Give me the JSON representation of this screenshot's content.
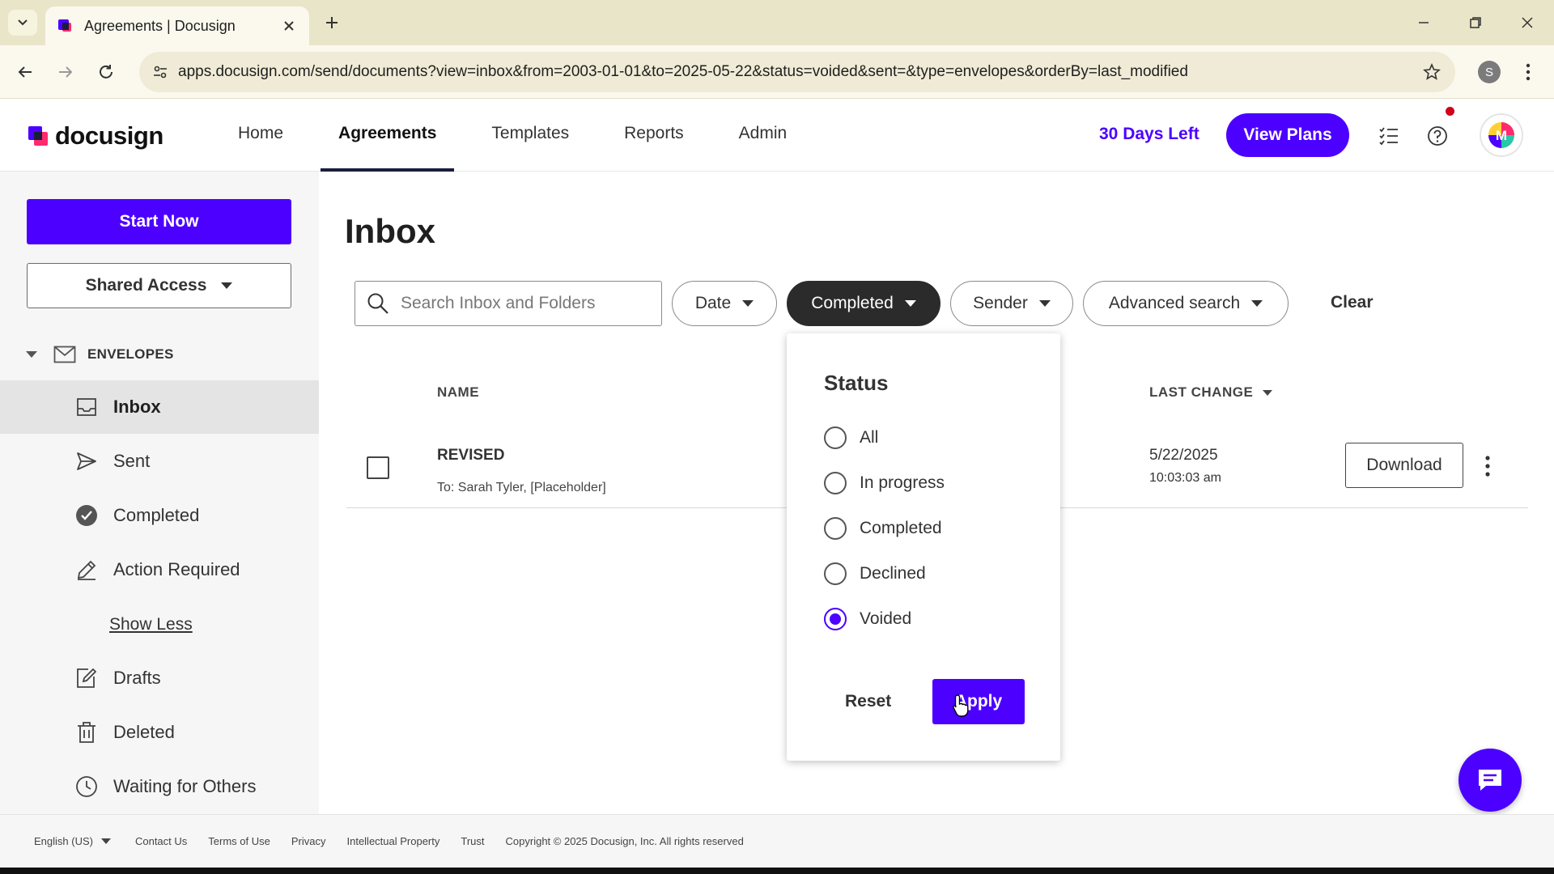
{
  "browser": {
    "tab_title": "Agreements | Docusign",
    "url": "apps.docusign.com/send/documents?view=inbox&from=2003-01-01&to=2025-05-22&status=voided&sent=&type=envelopes&orderBy=last_modified",
    "profile_initial": "S"
  },
  "header": {
    "logo_text": "docusign",
    "nav": [
      "Home",
      "Agreements",
      "Templates",
      "Reports",
      "Admin"
    ],
    "active_nav": "Agreements",
    "days_left": "30 Days Left",
    "view_plans": "View Plans",
    "avatar_initial": "M"
  },
  "sidebar": {
    "start_now": "Start Now",
    "shared_access": "Shared Access",
    "envelopes_label": "ENVELOPES",
    "items": [
      {
        "label": "Inbox",
        "icon": "inbox-icon"
      },
      {
        "label": "Sent",
        "icon": "send-icon"
      },
      {
        "label": "Completed",
        "icon": "check-circle-icon"
      },
      {
        "label": "Action Required",
        "icon": "pen-icon"
      },
      {
        "label": "Drafts",
        "icon": "draft-icon"
      },
      {
        "label": "Deleted",
        "icon": "trash-icon"
      },
      {
        "label": "Waiting for Others",
        "icon": "clock-icon"
      }
    ],
    "show_less": "Show Less"
  },
  "main": {
    "title": "Inbox",
    "search_placeholder": "Search Inbox and Folders",
    "filters": {
      "date": "Date",
      "status": "Completed",
      "sender": "Sender",
      "advanced": "Advanced search",
      "clear": "Clear"
    },
    "columns": {
      "name": "NAME",
      "last_change": "LAST CHANGE"
    },
    "rows": [
      {
        "name": "REVISED",
        "to": "To: Sarah Tyler, [Placeholder]",
        "date": "5/22/2025",
        "time": "10:03:03 am",
        "action": "Download"
      }
    ]
  },
  "status_dropdown": {
    "title": "Status",
    "options": [
      "All",
      "In progress",
      "Completed",
      "Declined",
      "Voided"
    ],
    "selected": "Voided",
    "reset": "Reset",
    "apply": "Apply"
  },
  "footer": {
    "language": "English (US)",
    "links": [
      "Contact Us",
      "Terms of Use",
      "Privacy",
      "Intellectual Property",
      "Trust"
    ],
    "copyright": "Copyright © 2025 Docusign, Inc. All rights reserved"
  },
  "colors": {
    "brand": "#4c00ff",
    "dark_pill": "#2b2b2b",
    "browser_chrome": "#e9e5c8",
    "notification": "#d0021b"
  }
}
